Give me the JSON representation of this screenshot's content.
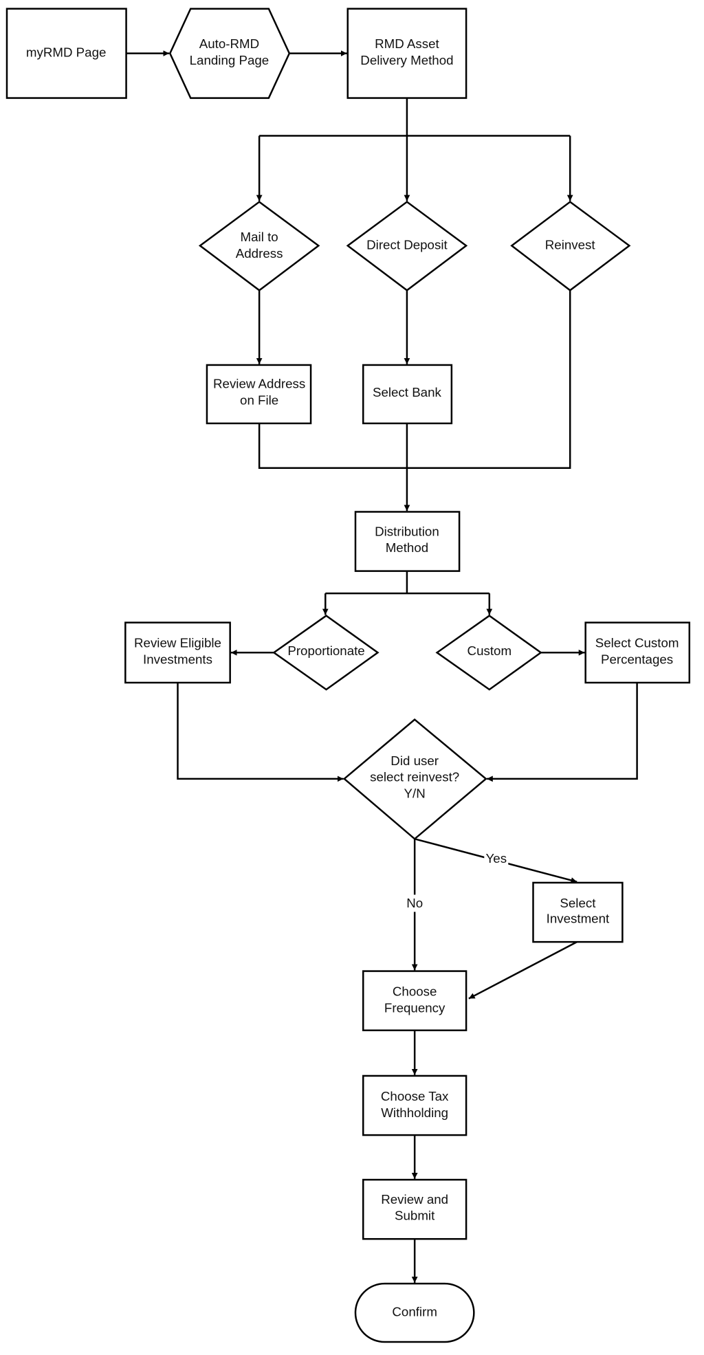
{
  "colors": {
    "stroke": "#000000",
    "fill": "#ffffff",
    "text": "#111111"
  },
  "nodes": {
    "myrmd": [
      "myRMD Page"
    ],
    "landing": [
      "Auto-RMD",
      "Landing Page"
    ],
    "delivery": [
      "RMD Asset",
      "Delivery Method"
    ],
    "mail": [
      "Mail to",
      "Address"
    ],
    "direct": [
      "Direct Deposit"
    ],
    "reinvest": [
      "Reinvest"
    ],
    "review_address": [
      "Review Address",
      "on File"
    ],
    "select_bank": [
      "Select Bank"
    ],
    "distribution": [
      "Distribution",
      "Method"
    ],
    "proportionate": [
      "Proportionate"
    ],
    "custom": [
      "Custom"
    ],
    "review_eligible": [
      "Review Eligible",
      "Investments"
    ],
    "select_custom": [
      "Select Custom",
      "Percentages"
    ],
    "decision": [
      "Did user",
      "select reinvest?",
      "Y/N"
    ],
    "select_investment": [
      "Select",
      "Investment"
    ],
    "frequency": [
      "Choose",
      "Frequency"
    ],
    "tax": [
      "Choose Tax",
      "Withholding"
    ],
    "review_submit": [
      "Review and",
      "Submit"
    ],
    "confirm": [
      "Confirm"
    ]
  },
  "edge_labels": {
    "yes": "Yes",
    "no": "No"
  }
}
